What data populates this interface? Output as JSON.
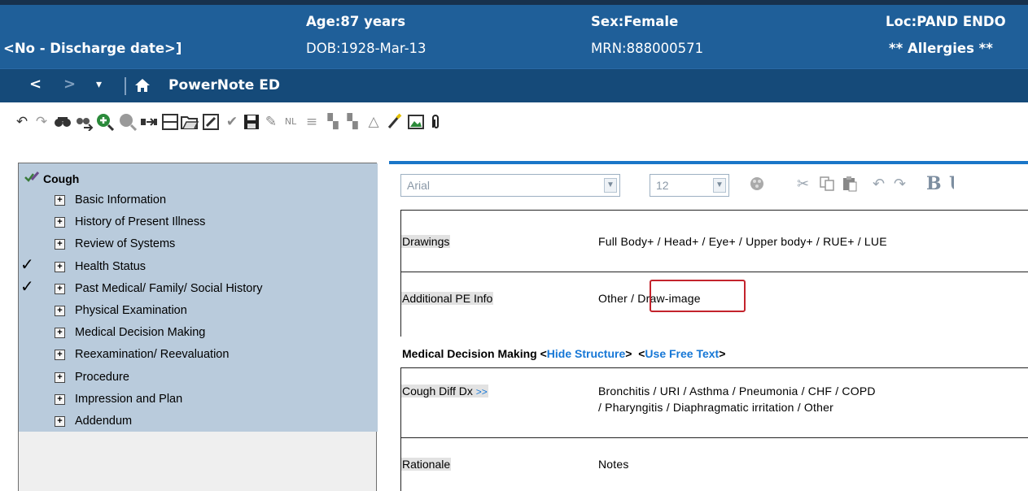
{
  "banner": {
    "discharge": "<No - Discharge date>]",
    "age": "Age:87 years",
    "dob": "DOB:1928-Mar-13",
    "sex": "Sex:Female",
    "mrn": "MRN:888000571",
    "loc": "Loc:PAND ENDO",
    "allergies": "** Allergies **"
  },
  "nav": {
    "back_glyph": "<",
    "forward_glyph": ">",
    "menu_glyph": "▾",
    "home_icon": "home-icon",
    "title": "PowerNote ED"
  },
  "toolbar": {
    "icons": [
      "undo-icon",
      "redo-icon",
      "find-icon",
      "find-next-icon",
      "zoom-in-icon",
      "zoom-out-icon",
      "insert-icon",
      "table-icon",
      "open-folder-icon",
      "edit-icon",
      "check-icon",
      "save-icon",
      "sign-icon",
      "nl-icon",
      "justify-icon",
      "copy-format-icon",
      "paste-format-icon",
      "triangle-ruler-icon",
      "highlighter-icon",
      "image-icon",
      "attachment-icon"
    ]
  },
  "tree": {
    "title": "Cough",
    "items": [
      {
        "label": "Basic Information",
        "checked": false
      },
      {
        "label": "History of Present Illness",
        "checked": false
      },
      {
        "label": "Review of Systems",
        "checked": false
      },
      {
        "label": "Health Status",
        "checked": true
      },
      {
        "label": "Past Medical/ Family/ Social History",
        "checked": true
      },
      {
        "label": "Physical Examination",
        "checked": false
      },
      {
        "label": "Medical Decision Making",
        "checked": false
      },
      {
        "label": "Reexamination/ Reevaluation",
        "checked": false
      },
      {
        "label": "Procedure",
        "checked": false
      },
      {
        "label": "Impression and Plan",
        "checked": false
      },
      {
        "label": "Addendum",
        "checked": false
      }
    ]
  },
  "editor": {
    "font_name": "Arial",
    "font_size": "12",
    "bold_label": "B",
    "drawings_label": "Drawings",
    "drawings_value": "Full Body+ / Head+ / Eye+ / Upper body+ / RUE+ / LUE",
    "addl_label": "Additional PE Info",
    "addl_value_prefix": "Other / ",
    "addl_value_draw": "Draw-image",
    "mdm_title": "Medical Decision Making",
    "lt1": " <",
    "hide_structure": "Hide Structure",
    "gt1": ">",
    "lt2": "  <",
    "use_free_text": "Use Free Text",
    "gt2": ">",
    "cough_label": "Cough Diff Dx",
    "cough_arrow": ">>",
    "cough_value_1": "Bronchitis / URI / Asthma / Pneumonia / CHF / COPD",
    "cough_value_2": "/ Pharyngitis / Diaphragmatic irritation / Other",
    "rationale_label": "Rationale",
    "rationale_value": "Notes"
  }
}
